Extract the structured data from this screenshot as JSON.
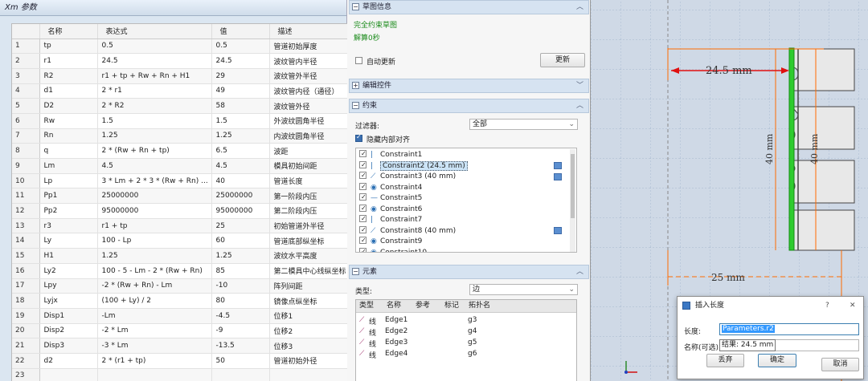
{
  "params": {
    "title": "Xm 参数",
    "headers": [
      "名称",
      "表达式",
      "值",
      "描述"
    ],
    "rows": [
      [
        "1",
        "tp",
        "0.5",
        "0.5",
        "管道初始厚度"
      ],
      [
        "2",
        "r1",
        "24.5",
        "24.5",
        "波纹管内半径"
      ],
      [
        "3",
        "R2",
        "r1 + tp + Rw + Rn + H1",
        "29",
        "波纹管外半径"
      ],
      [
        "4",
        "d1",
        "2 * r1",
        "49",
        "波纹管内径（通径）"
      ],
      [
        "5",
        "D2",
        "2 * R2",
        "58",
        "波纹管外径"
      ],
      [
        "6",
        "Rw",
        "1.5",
        "1.5",
        "外波纹圆角半径"
      ],
      [
        "7",
        "Rn",
        "1.25",
        "1.25",
        "内波纹圆角半径"
      ],
      [
        "8",
        "q",
        "2 * (Rw + Rn + tp)",
        "6.5",
        "波距"
      ],
      [
        "9",
        "Lm",
        "4.5",
        "4.5",
        "模具初始间距"
      ],
      [
        "10",
        "Lp",
        "3 * Lm + 2 * 3 * (Rw + Rn) ...",
        "40",
        "管道长度"
      ],
      [
        "11",
        "Pp1",
        "25000000",
        "25000000",
        "第一阶段内压"
      ],
      [
        "12",
        "Pp2",
        "95000000",
        "95000000",
        "第二阶段内压"
      ],
      [
        "13",
        "r3",
        "r1 + tp",
        "25",
        "初始管道外半径"
      ],
      [
        "14",
        "Ly",
        "100 - Lp",
        "60",
        "管道底部纵坐标"
      ],
      [
        "15",
        "H1",
        "1.25",
        "1.25",
        "波纹水平高度"
      ],
      [
        "16",
        "Ly2",
        "100 - 5 - Lm - 2 * (Rw + Rn)",
        "85",
        "第二模具中心线纵坐标"
      ],
      [
        "17",
        "Lpy",
        "-2 * (Rw + Rn) - Lm",
        "-10",
        "阵列间距"
      ],
      [
        "18",
        "Lyjx",
        "(100 + Ly) / 2",
        "80",
        "镜像点纵坐标"
      ],
      [
        "19",
        "Disp1",
        "-Lm",
        "-4.5",
        "位移1"
      ],
      [
        "20",
        "Disp2",
        "-2 * Lm",
        "-9",
        "位移2"
      ],
      [
        "21",
        "Disp3",
        "-3 * Lm",
        "-13.5",
        "位移3"
      ],
      [
        "22",
        "d2",
        "2 * (r1 + tp)",
        "50",
        "管道初始外径"
      ],
      [
        "23",
        "",
        "",
        "",
        ""
      ]
    ]
  },
  "panel": {
    "sketch_info": "草图信息",
    "fully_constrained": "完全约束草图",
    "solve_time": "解算0秒",
    "auto_update": "自动更新",
    "update_btn": "更新",
    "edit_controls": "编辑控件",
    "constraints": "约束",
    "filter_label": "过滤器:",
    "filter_value": "全部",
    "hide_internal": "隐藏内部对齐",
    "constraint_items": [
      "Constraint1",
      "Constraint2 (24.5 mm)",
      "Constraint3 (40 mm)",
      "Constraint4",
      "Constraint5",
      "Constraint6",
      "Constraint7",
      "Constraint8 (40 mm)",
      "Constraint9",
      "Constraint10"
    ],
    "elements": "元素",
    "type_label": "类型:",
    "type_value": "边",
    "elem_headers": [
      "类型",
      "名称",
      "参考",
      "标记",
      "拓扑名"
    ],
    "elem_rows": [
      [
        "线",
        "Edge1",
        "g3"
      ],
      [
        "线",
        "Edge2",
        "g4"
      ],
      [
        "线",
        "Edge3",
        "g5"
      ],
      [
        "线",
        "Edge4",
        "g6"
      ]
    ]
  },
  "canvas": {
    "dim_24_5": "24.5 mm",
    "dim_40a": "40 mm",
    "dim_40b": "40 mm",
    "dim_25": "25 mm"
  },
  "dialog": {
    "title": "插入长度",
    "help": "?",
    "close": "✕",
    "length_label": "长度:",
    "length_value": "Parameters.r2",
    "name_label": "名称(可选):",
    "tooltip": "结果: 24.5 mm",
    "discard": "丢弃",
    "ok": "确定",
    "cancel": "取消"
  }
}
